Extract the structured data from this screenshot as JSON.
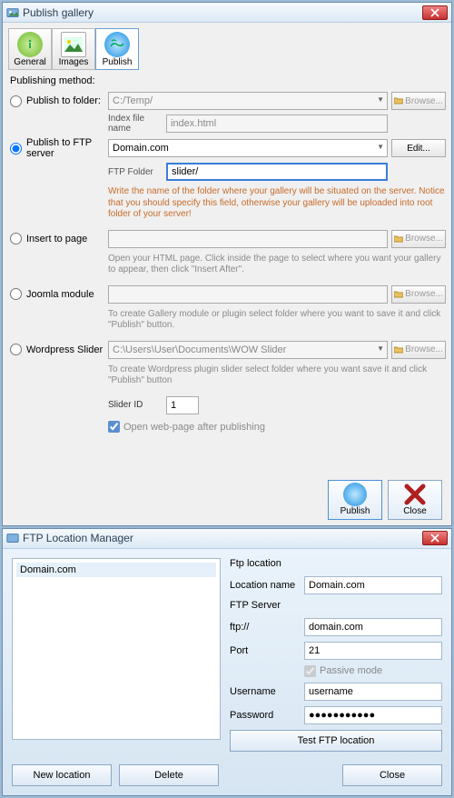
{
  "publish_gallery": {
    "title": "Publish gallery",
    "tabs": {
      "general": "General",
      "images": "Images",
      "publish": "Publish"
    },
    "section_label": "Publishing method:",
    "opts": {
      "folder": {
        "label": "Publish to folder:",
        "path": "C:/Temp/",
        "browse": "Browse...",
        "index_label": "Index file name",
        "index_value": "index.html"
      },
      "ftp": {
        "label": "Publish to FTP server",
        "server": "Domain.com",
        "edit": "Edit...",
        "ftp_folder_label": "FTP Folder",
        "ftp_folder_value": "slider/",
        "hint": "Write the name of the folder where your gallery will be situated on the server. Notice that you should specify this field, otherwise your gallery will be uploaded into root folder of your server!"
      },
      "insert": {
        "label": "Insert to page",
        "browse": "Browse...",
        "hint": "Open your HTML page. Click inside the page to select where you want your gallery to appear, then click \"Insert After\"."
      },
      "joomla": {
        "label": "Joomla module",
        "browse": "Browse...",
        "hint": "To create Gallery module or plugin select folder where you want to save it and click \"Publish\" button."
      },
      "wp": {
        "label": "Wordpress Slider",
        "path": "C:\\Users\\User\\Documents\\WOW Slider",
        "browse": "Browse...",
        "hint": "To create Wordpress plugin slider select folder where you want save it and click \"Publish\" button"
      }
    },
    "slider_id_label": "Slider ID",
    "slider_id_value": "1",
    "open_web_label": "Open web-page after publishing",
    "publish_btn": "Publish",
    "close_btn": "Close"
  },
  "flm": {
    "title": "FTP Location Manager",
    "list_item": "Domain.com",
    "section": "Ftp location",
    "location_name_label": "Location name",
    "location_name": "Domain.com",
    "server_label": "FTP Server",
    "protocol": "ftp://",
    "host": "domain.com",
    "port_label": "Port",
    "port": "21",
    "passive_label": "Passive mode",
    "username_label": "Username",
    "username": "username",
    "password_label": "Password",
    "password": "●●●●●●●●●●●",
    "test_btn": "Test FTP location",
    "new_location": "New location",
    "delete": "Delete",
    "close": "Close"
  }
}
